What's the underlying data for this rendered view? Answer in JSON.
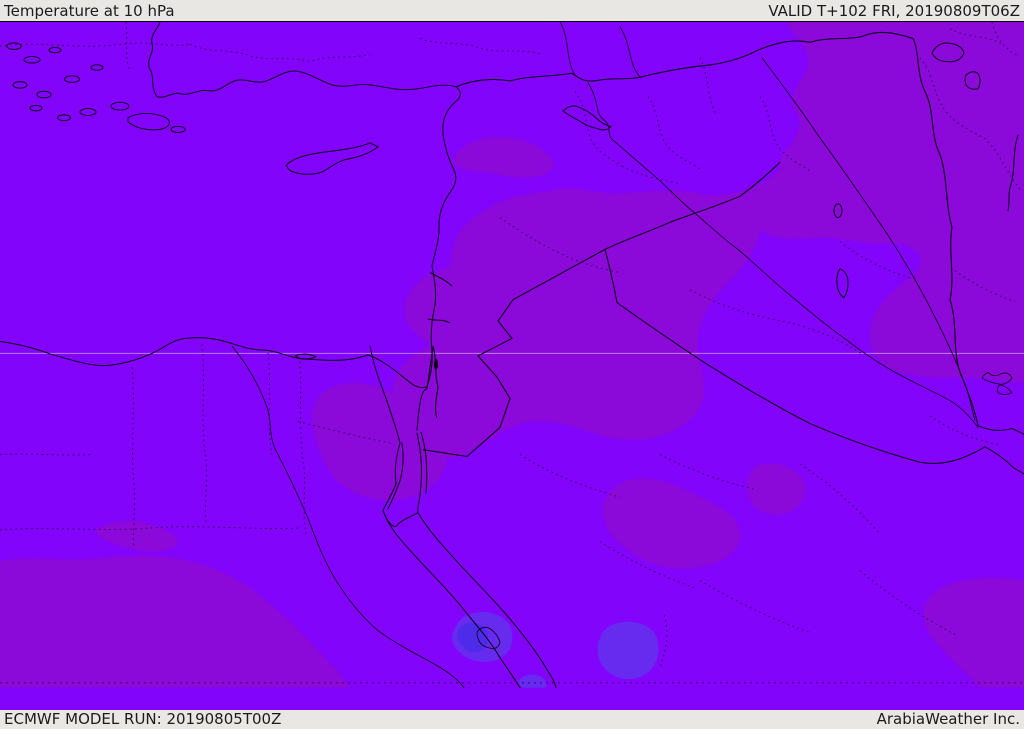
{
  "header": {
    "title": "Temperature at 10 hPa",
    "valid": "VALID T+102 FRI, 20190809T06Z"
  },
  "footer": {
    "model_run": "ECMWF MODEL RUN: 20190805T00Z",
    "branding": "ArabiaWeather Inc."
  },
  "map": {
    "description": "Temperature shading map over the Middle East / Eastern Mediterranean",
    "legend_visible": false
  },
  "colors": {
    "base": "#8204fb",
    "band_dark": "#8b09d9",
    "band_blue": "#672aef",
    "band_deep_blue": "#4e2be9",
    "coast": "#0b0016",
    "admin_dots": "#2b0340",
    "gridline": "#d9c9f2",
    "bar_bg": "#e9e7e4",
    "bar_text": "#1b1b1b"
  }
}
